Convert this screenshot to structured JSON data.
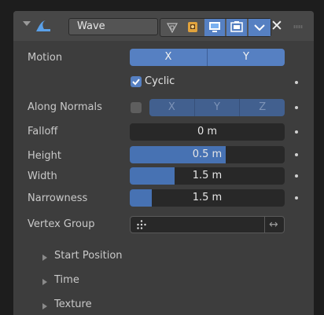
{
  "header": {
    "modifier_name": "Wave",
    "icons": [
      "collapse-arrow-icon",
      "wave-modifier-icon",
      "vertex-triangle-icon",
      "editmode-icon",
      "viewport-icon",
      "render-icon",
      "dropdown-chevron-icon",
      "close-icon",
      "drag-handle-icon"
    ]
  },
  "motion": {
    "label": "Motion",
    "x_label": "X",
    "y_label": "Y",
    "x_on": true,
    "y_on": true
  },
  "cyclic": {
    "label": "Cyclic",
    "checked": true
  },
  "along_normals": {
    "label": "Along Normals",
    "checked": false,
    "x_label": "X",
    "y_label": "Y",
    "z_label": "Z"
  },
  "falloff": {
    "label": "Falloff",
    "value": "0 m",
    "fill": 0.0
  },
  "height": {
    "label": "Height",
    "value": "0.5 m",
    "fill": 0.62
  },
  "width": {
    "label": "Width",
    "value": "1.5 m",
    "fill": 0.29
  },
  "narrowness": {
    "label": "Narrowness",
    "value": "1.5 m",
    "fill": 0.14
  },
  "vertex_group": {
    "label": "Vertex Group",
    "value": ""
  },
  "subpanels": [
    {
      "label": "Start Position"
    },
    {
      "label": "Time"
    },
    {
      "label": "Texture"
    }
  ],
  "colors": {
    "accent": "#5680c2",
    "panel": "#3d3d3d",
    "slider_bg": "#282828"
  }
}
